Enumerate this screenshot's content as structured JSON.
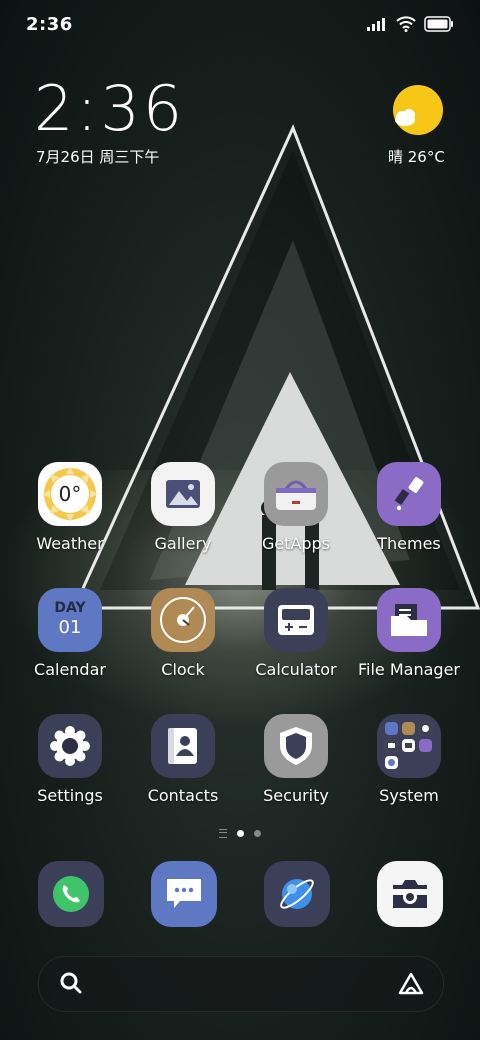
{
  "status_bar": {
    "time": "2:36"
  },
  "clock_widget": {
    "time": "2:36",
    "date": "7月26日 周三下午"
  },
  "weather_widget": {
    "text": "晴 26°C"
  },
  "apps": {
    "weather": {
      "label": "Weather",
      "icon_text": "0°"
    },
    "gallery": {
      "label": "Gallery"
    },
    "getapps": {
      "label": "GetApps"
    },
    "themes": {
      "label": "Themes"
    },
    "calendar": {
      "label": "Calendar",
      "icon_day": "DAY",
      "icon_num": "01"
    },
    "clock": {
      "label": "Clock"
    },
    "calculator": {
      "label": "Calculator"
    },
    "filemanager": {
      "label": "File Manager"
    },
    "settings": {
      "label": "Settings"
    },
    "contacts": {
      "label": "Contacts"
    },
    "security": {
      "label": "Security"
    },
    "system": {
      "label": "System"
    }
  },
  "dock": [
    "phone",
    "messages",
    "browser",
    "camera"
  ],
  "colors": {
    "accent_purple": "#8a6cc7",
    "tile_slate": "#3b3f58",
    "calendar_blue": "#5f78c4",
    "clock_gold": "#b08a54",
    "phone_green": "#3fc46a",
    "sun_yellow": "#f7c616"
  }
}
